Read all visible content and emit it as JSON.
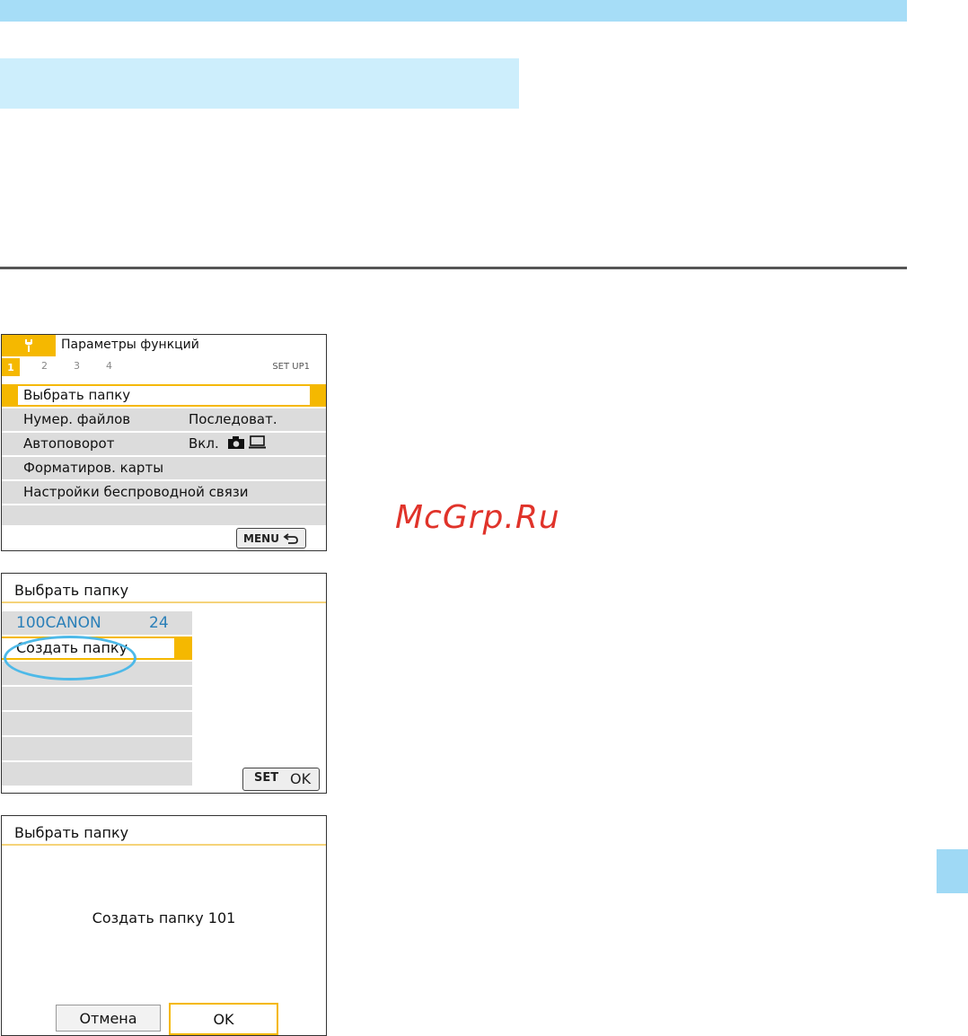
{
  "watermark": "McGrp.Ru",
  "screen1": {
    "header_title": "Параметры функций",
    "tabs": [
      "1",
      "2",
      "3",
      "4"
    ],
    "tab_code": "SET UP1",
    "rows": [
      {
        "label": "Выбрать папку",
        "value": ""
      },
      {
        "label": "Нумер. файлов",
        "value": "Последоват."
      },
      {
        "label": "Автоповорот",
        "value": "Вкл."
      },
      {
        "label": "Форматиров. карты",
        "value": ""
      },
      {
        "label": "Настройки беспроводной связи",
        "value": ""
      }
    ],
    "menu_button": "MENU"
  },
  "screen2": {
    "title": "Выбрать папку",
    "folder_name": "100CANON",
    "folder_count": "24",
    "create_label": "Создать папку",
    "set_key": "SET",
    "set_value": "OK"
  },
  "screen3": {
    "title": "Выбрать папку",
    "message": "Создать папку 101",
    "cancel_label": "Отмена",
    "ok_label": "OK"
  },
  "colors": {
    "accent": "#f5b800",
    "highlight_oval": "#4db9e8",
    "band_dark": "#a6ddf7",
    "band_light": "#cdeefc",
    "watermark": "#e0332a"
  }
}
